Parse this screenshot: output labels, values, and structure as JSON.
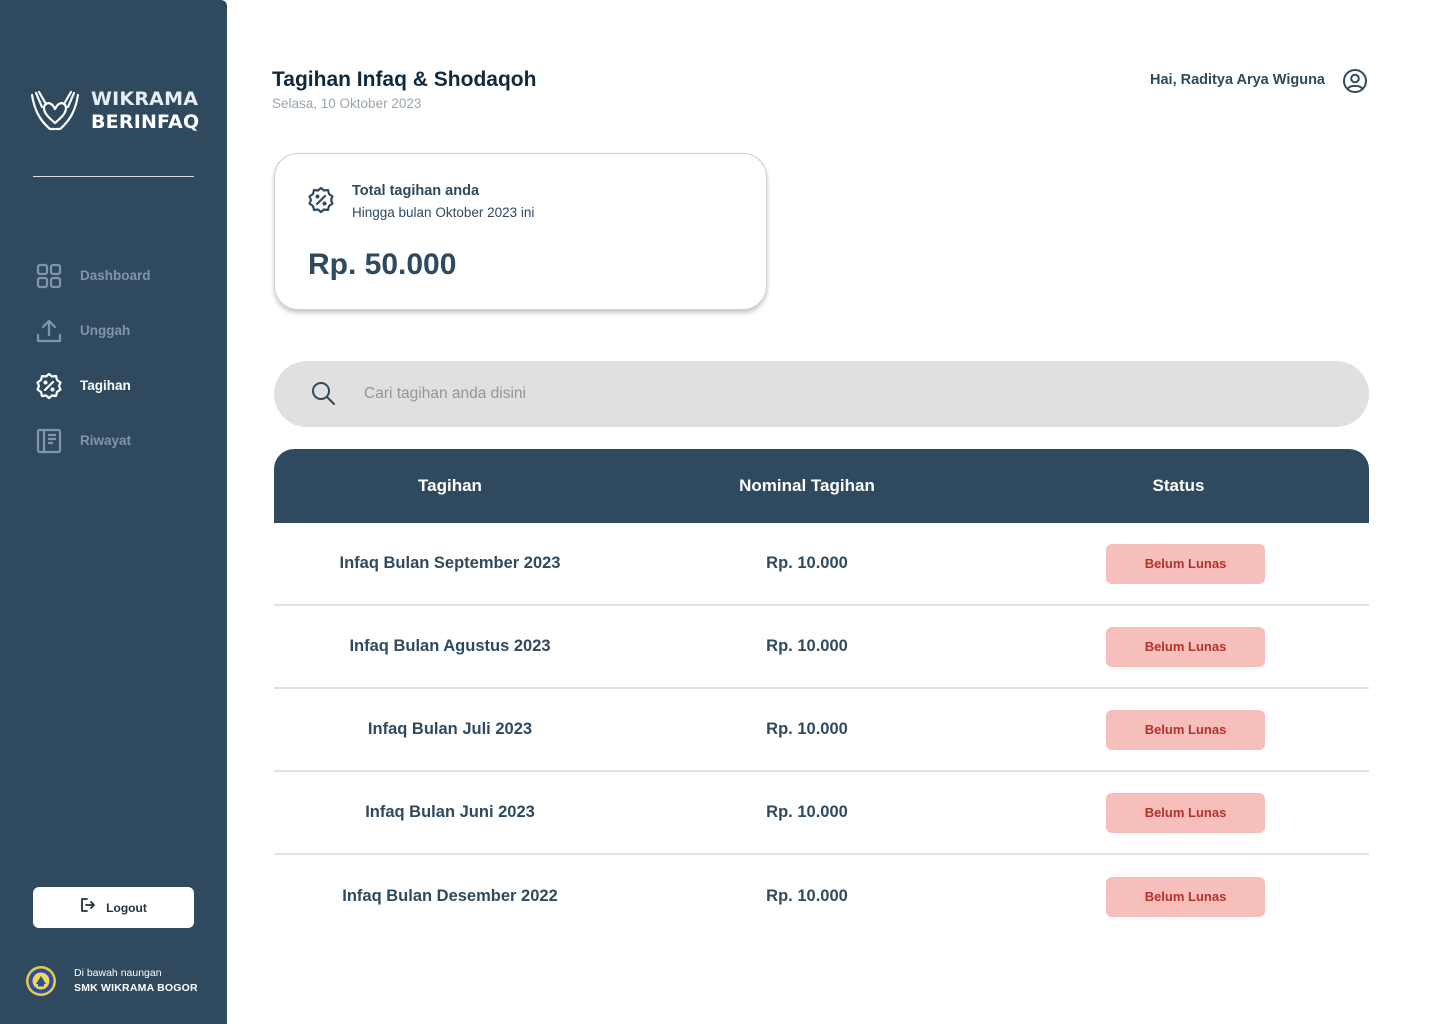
{
  "sidebar": {
    "logo": {
      "line1": "WIKRAMA",
      "line2": "BERINFAQ"
    },
    "nav": [
      {
        "label": "Dashboard",
        "icon": "grid-icon",
        "active": false
      },
      {
        "label": "Unggah",
        "icon": "upload-icon",
        "active": false
      },
      {
        "label": "Tagihan",
        "icon": "discount-badge-icon",
        "active": true
      },
      {
        "label": "Riwayat",
        "icon": "history-book-icon",
        "active": false
      }
    ],
    "logout_label": "Logout",
    "footer": {
      "line1": "Di bawah naungan",
      "line2": "SMK WIKRAMA BOGOR"
    }
  },
  "header": {
    "title": "Tagihan Infaq & Shodaqoh",
    "date": "Selasa, 10 Oktober 2023",
    "greeting": "Hai, Raditya Arya Wiguna"
  },
  "summary": {
    "title": "Total tagihan anda",
    "subtitle": "Hingga bulan Oktober 2023 ini",
    "amount": "Rp. 50.000"
  },
  "search": {
    "placeholder": "Cari tagihan anda disini",
    "value": ""
  },
  "table": {
    "headers": [
      "Tagihan",
      "Nominal Tagihan",
      "Status"
    ],
    "rows": [
      {
        "name": "Infaq Bulan September 2023",
        "amount": "Rp. 10.000",
        "status": "Belum Lunas"
      },
      {
        "name": "Infaq Bulan Agustus 2023",
        "amount": "Rp. 10.000",
        "status": "Belum Lunas"
      },
      {
        "name": "Infaq Bulan Juli 2023",
        "amount": "Rp. 10.000",
        "status": "Belum Lunas"
      },
      {
        "name": "Infaq Bulan Juni 2023",
        "amount": "Rp. 10.000",
        "status": "Belum Lunas"
      },
      {
        "name": "Infaq Bulan Desember 2022",
        "amount": "Rp. 10.000",
        "status": "Belum Lunas"
      }
    ]
  },
  "colors": {
    "primary": "#2f4a5f",
    "status_bg": "#f6bfbb",
    "status_text": "#b5312c",
    "search_bg": "#e0e0e0"
  }
}
